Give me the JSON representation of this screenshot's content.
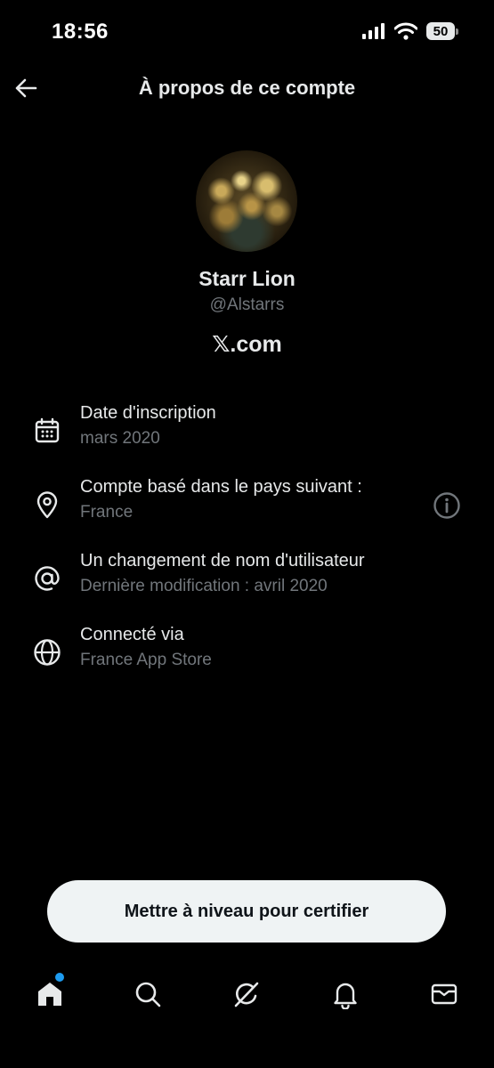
{
  "status_bar": {
    "time": "18:56",
    "battery": "50"
  },
  "header": {
    "title": "À propos de ce compte"
  },
  "profile": {
    "name": "Starr Lion",
    "handle": "@Alstarrs",
    "brand": "𝕏.com"
  },
  "info_items": [
    {
      "icon": "calendar-icon",
      "title": "Date d'inscription",
      "subtitle": "mars 2020"
    },
    {
      "icon": "location-pin-icon",
      "title": "Compte basé dans le pays suivant :",
      "subtitle": "France",
      "extra_icon": "info-icon"
    },
    {
      "icon": "at-sign-icon",
      "title": "Un changement de nom d'utilisateur",
      "subtitle": "Dernière modification : avril 2020"
    },
    {
      "icon": "globe-icon",
      "title": "Connecté via",
      "subtitle": "France App Store"
    }
  ],
  "upgrade_button": {
    "label": "Mettre à niveau pour certifier"
  },
  "bottom_nav": {
    "items": [
      "home-icon",
      "search-icon",
      "grok-icon",
      "notifications-icon",
      "messages-icon"
    ],
    "active": "home-icon",
    "notification_dot_color": "#1d9bf0"
  },
  "colors": {
    "background": "#000000",
    "text_primary": "#e7e9ea",
    "text_secondary": "#71767b",
    "button_bg": "#eff3f4",
    "accent": "#1d9bf0"
  }
}
